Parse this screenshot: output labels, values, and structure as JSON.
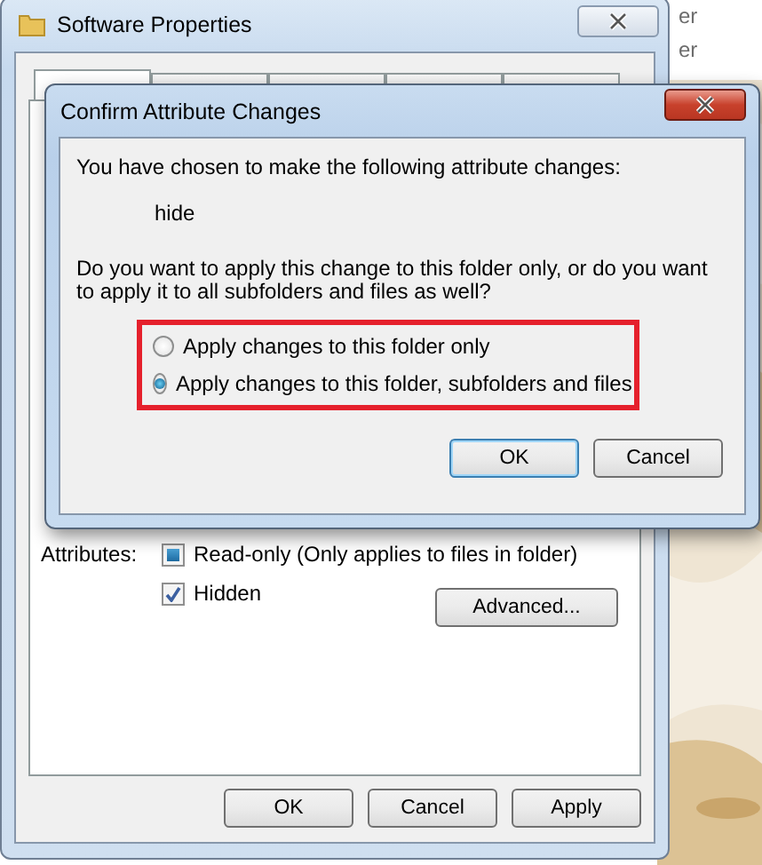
{
  "background_window": {
    "fragments": [
      "er",
      "er"
    ]
  },
  "properties_window": {
    "title": "Software Properties",
    "tabs": [
      {
        "selected": true
      },
      {
        "selected": false
      },
      {
        "selected": false
      },
      {
        "selected": false
      },
      {
        "selected": false
      }
    ],
    "attributes_label": "Attributes:",
    "attributes": [
      {
        "label": "Read-only (Only applies to files in folder)",
        "checked": false,
        "mixed": true
      },
      {
        "label": "Hidden",
        "checked": true,
        "mixed": false
      }
    ],
    "advanced_button": "Advanced...",
    "buttons": [
      "OK",
      "Cancel",
      "Apply"
    ]
  },
  "confirm_dialog": {
    "title": "Confirm Attribute Changes",
    "intro": "You have chosen to make the following attribute changes:",
    "change": "hide",
    "question": "Do you want to apply this change to this folder only, or do you want to apply it to all subfolders and files as well?",
    "options": [
      {
        "label": "Apply changes to this folder only",
        "selected": false
      },
      {
        "label": "Apply changes to this folder, subfolders and files",
        "selected": true
      }
    ],
    "buttons": [
      {
        "label": "OK",
        "default": true
      },
      {
        "label": "Cancel",
        "default": false
      }
    ]
  }
}
